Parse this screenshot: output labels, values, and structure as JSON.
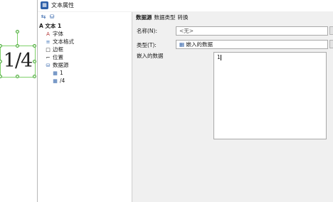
{
  "canvas": {
    "text": "1/4"
  },
  "dialog": {
    "title": "文本属性",
    "toolbar": {
      "tree_view_icon": "tree-icon",
      "data_icon": "database-icon"
    },
    "tree": {
      "root": "A  文本 1",
      "items": [
        {
          "label": "字体",
          "icon": "font-icon"
        },
        {
          "label": "文本格式",
          "icon": "text-format-icon"
        },
        {
          "label": "边框",
          "icon": "border-icon"
        },
        {
          "label": "位置",
          "icon": "position-icon"
        },
        {
          "label": "数据源",
          "icon": "data-source-icon"
        }
      ],
      "sources": [
        {
          "label": "1"
        },
        {
          "label": "/4"
        }
      ]
    },
    "tabs": [
      "数据源",
      "数据类型",
      "转换"
    ],
    "fields": {
      "name_label": "名称(N):",
      "name_value": "<无>",
      "type_label": "类型(T):",
      "type_value": "嵌入的数据",
      "embedded_label": "嵌入的数据",
      "embedded_value": "1"
    }
  }
}
